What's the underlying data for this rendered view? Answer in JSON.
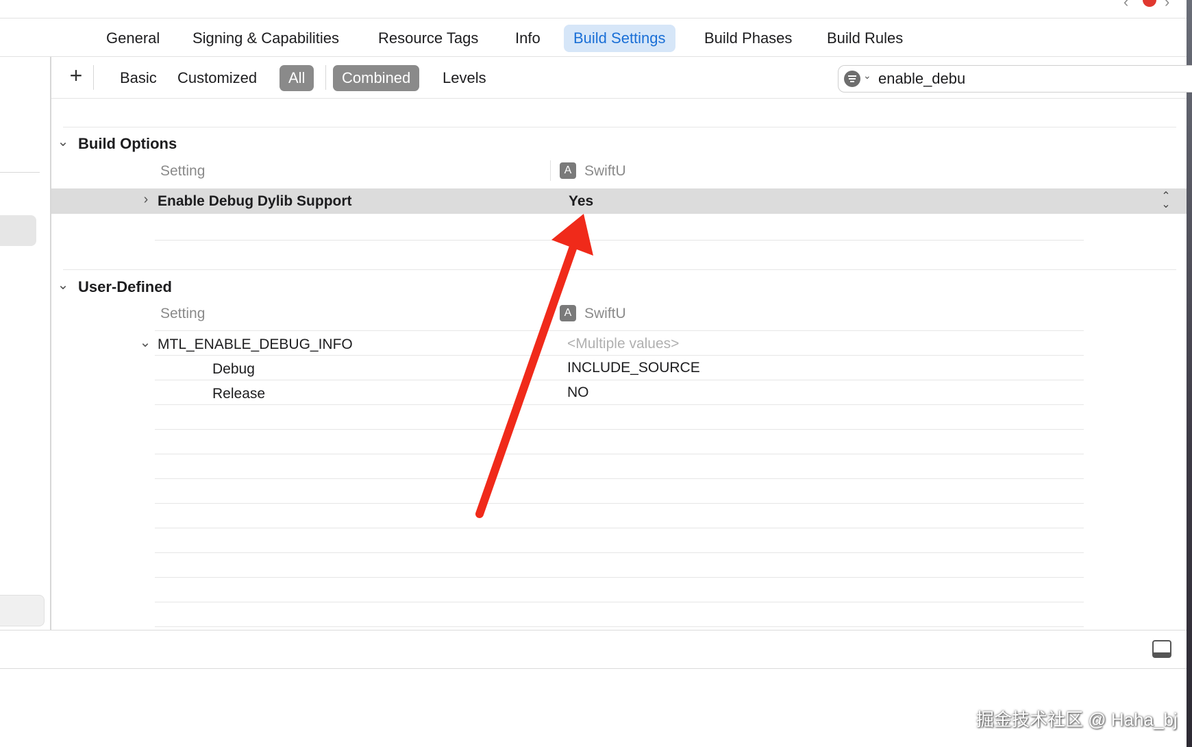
{
  "top_chrome": {
    "chevron_left": "‹",
    "chevron_right": "›"
  },
  "tabs": [
    {
      "label": "General",
      "selected": false
    },
    {
      "label": "Signing & Capabilities",
      "selected": false
    },
    {
      "label": "Resource Tags",
      "selected": false
    },
    {
      "label": "Info",
      "selected": false
    },
    {
      "label": "Build Settings",
      "selected": true
    },
    {
      "label": "Build Phases",
      "selected": false
    },
    {
      "label": "Build Rules",
      "selected": false
    }
  ],
  "filter_bar": {
    "add_label": "+",
    "scope_basic": "Basic",
    "scope_customized": "Customized",
    "scope_all": "All",
    "scope_combined": "Combined",
    "scope_levels": "Levels",
    "selected_scope": "All",
    "selected_view": "Combined"
  },
  "search": {
    "value": "enable_debu",
    "clear_glyph": "✕"
  },
  "sections": {
    "build_options": {
      "title": "Build Options",
      "setting_header": "Setting",
      "target_header": "SwiftU",
      "row": {
        "name": "Enable Debug Dylib Support",
        "value": "Yes"
      }
    },
    "user_defined": {
      "title": "User-Defined",
      "setting_header": "Setting",
      "target_header": "SwiftU",
      "row": {
        "name": "MTL_ENABLE_DEBUG_INFO",
        "value": "<Multiple values>"
      },
      "sub_rows": [
        {
          "name": "Debug",
          "value": "INCLUDE_SOURCE"
        },
        {
          "name": "Release",
          "value": "NO"
        }
      ]
    }
  },
  "glyphs": {
    "collapse": "⌄",
    "expand": "›",
    "target": "A",
    "stepper": "⌃⌄"
  },
  "annotation": {
    "arrow_color": "#f02a1a"
  },
  "watermark": "掘金技术社区 @ Haha_bj",
  "colors": {
    "accent": "#1a6fd6",
    "selected_tab_bg": "#d6e6f8",
    "scope_on": "#8a8a8a"
  }
}
